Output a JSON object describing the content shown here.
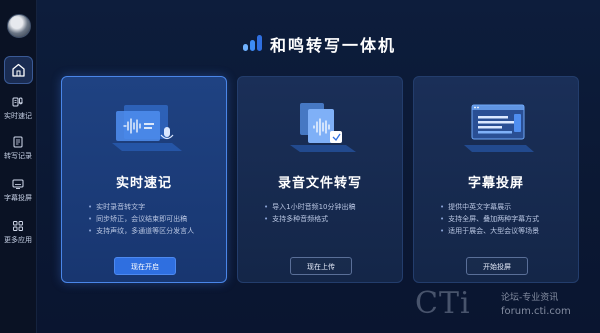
{
  "app": {
    "title": "和鸣转写一体机"
  },
  "sidebar": {
    "items": [
      {
        "id": "home",
        "label": ""
      },
      {
        "id": "realtime",
        "label": "实时速记"
      },
      {
        "id": "records",
        "label": "转写记录"
      },
      {
        "id": "subtitle",
        "label": "字幕投屏"
      },
      {
        "id": "more",
        "label": "更多应用"
      }
    ]
  },
  "cards": [
    {
      "title": "实时速记",
      "features": [
        "实时录音转文字",
        "同步矫正，会议结束即可出稿",
        "支持声纹，多通道等区分发言人"
      ],
      "button": "现在开启"
    },
    {
      "title": "录音文件转写",
      "features": [
        "导入1小时音频10分钟出稿",
        "支持多种音频格式"
      ],
      "button": "现在上传"
    },
    {
      "title": "字幕投屏",
      "features": [
        "提供中英文字幕展示",
        "支持全屏、叠加两种字幕方式",
        "适用于展会、大型会议等场景"
      ],
      "button": "开始投屏"
    }
  ],
  "watermark": {
    "brand": "CTi",
    "line1": "论坛-专业资讯",
    "line2": "forum.cti.com"
  },
  "colors": {
    "accent": "#2f6fe0",
    "background": "#0b1730",
    "card": "#1a2f58"
  }
}
